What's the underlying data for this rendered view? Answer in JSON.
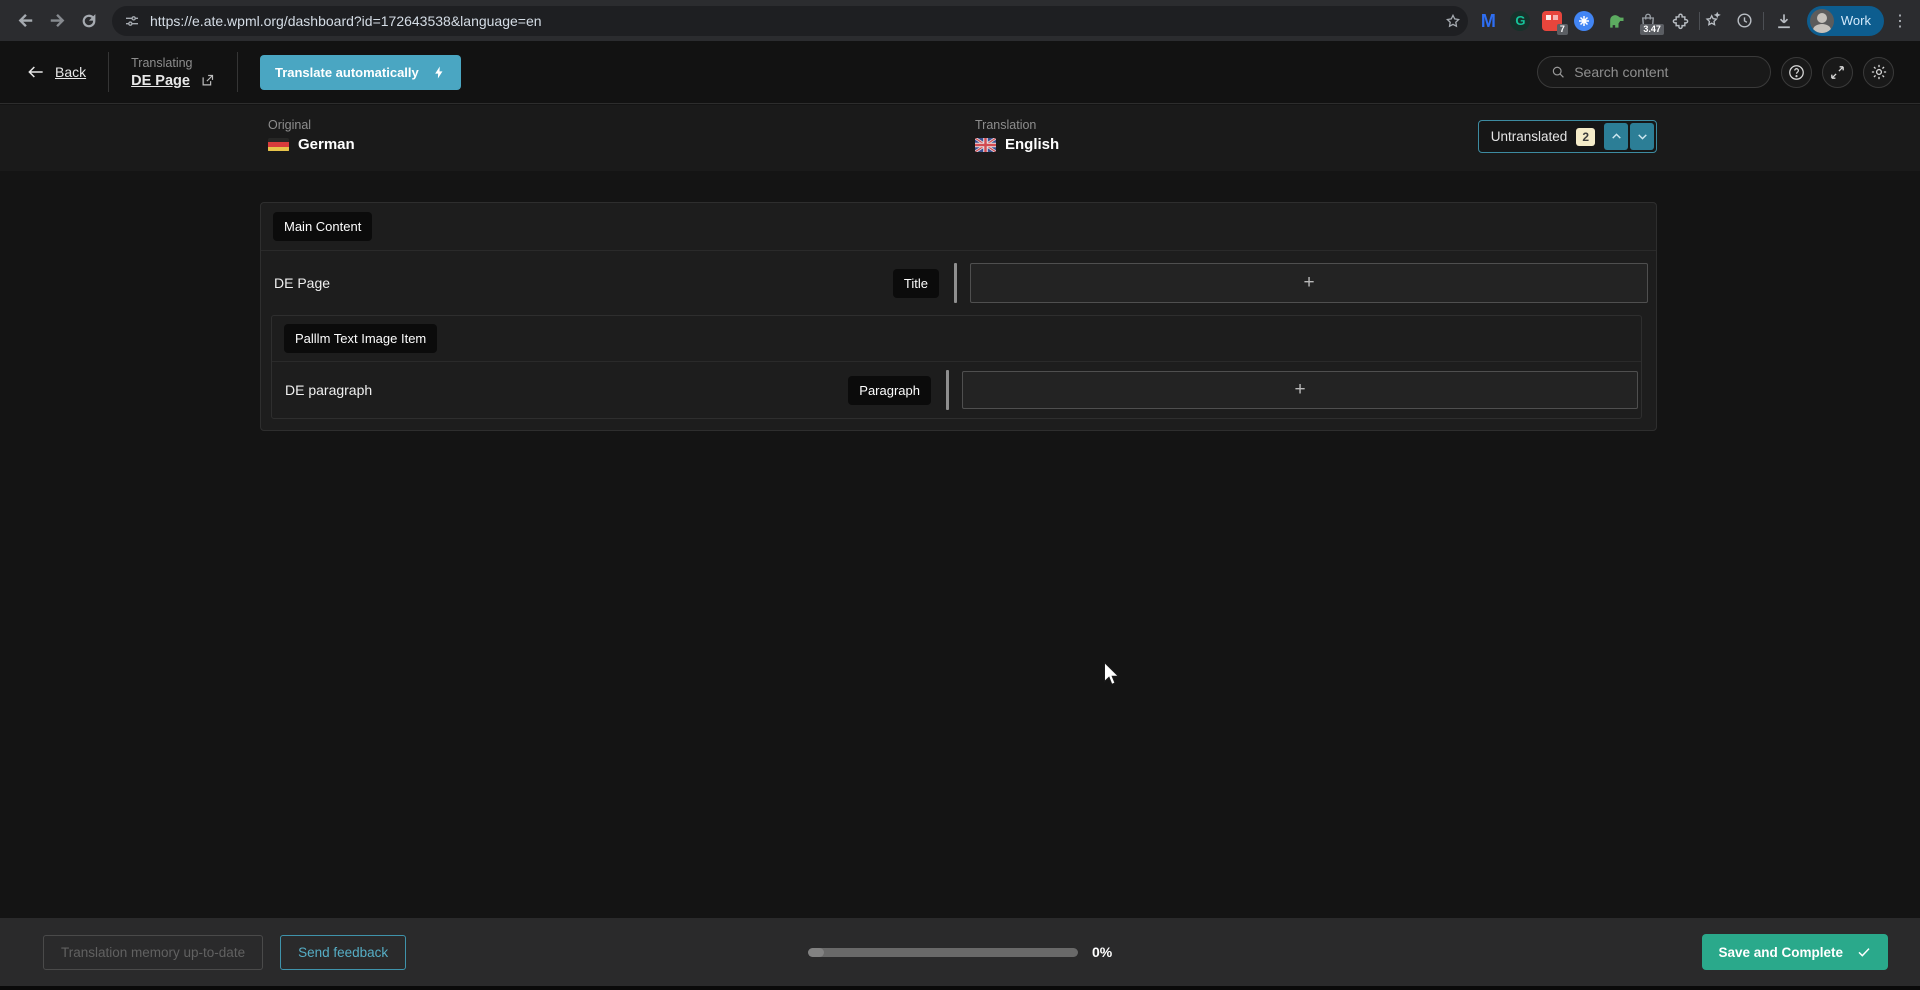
{
  "browser": {
    "url": "https://e.ate.wpml.org/dashboard?id=172643538&language=en",
    "extension_badge_red": "7",
    "extension_badge_bag": "3.47",
    "profile_label": "Work",
    "menu_glyph": "⋮"
  },
  "header": {
    "back_label": "Back",
    "translating_label": "Translating",
    "document_title": "DE Page",
    "translate_button_label": "Translate automatically",
    "search_placeholder": "Search content"
  },
  "languages": {
    "original_label": "Original",
    "original_name": "German",
    "translation_label": "Translation",
    "translation_name": "English",
    "filter": {
      "label": "Untranslated",
      "count": "2"
    }
  },
  "editor": {
    "section_chip": "Main Content",
    "rows": [
      {
        "source": "DE Page",
        "field_type": "Title",
        "add_symbol": "+"
      }
    ],
    "group_chip": "Palllm Text Image Item",
    "group_rows": [
      {
        "source": "DE paragraph",
        "field_type": "Paragraph",
        "add_symbol": "+"
      }
    ]
  },
  "footer": {
    "memory_button_label": "Translation memory up-to-date",
    "feedback_button_label": "Send feedback",
    "progress_label": "0%",
    "save_button_label": "Save and Complete"
  },
  "colors": {
    "accent_teal": "#4aa6c2",
    "accent_green": "#2aa98b",
    "badge_cream": "#f5ecc9"
  }
}
